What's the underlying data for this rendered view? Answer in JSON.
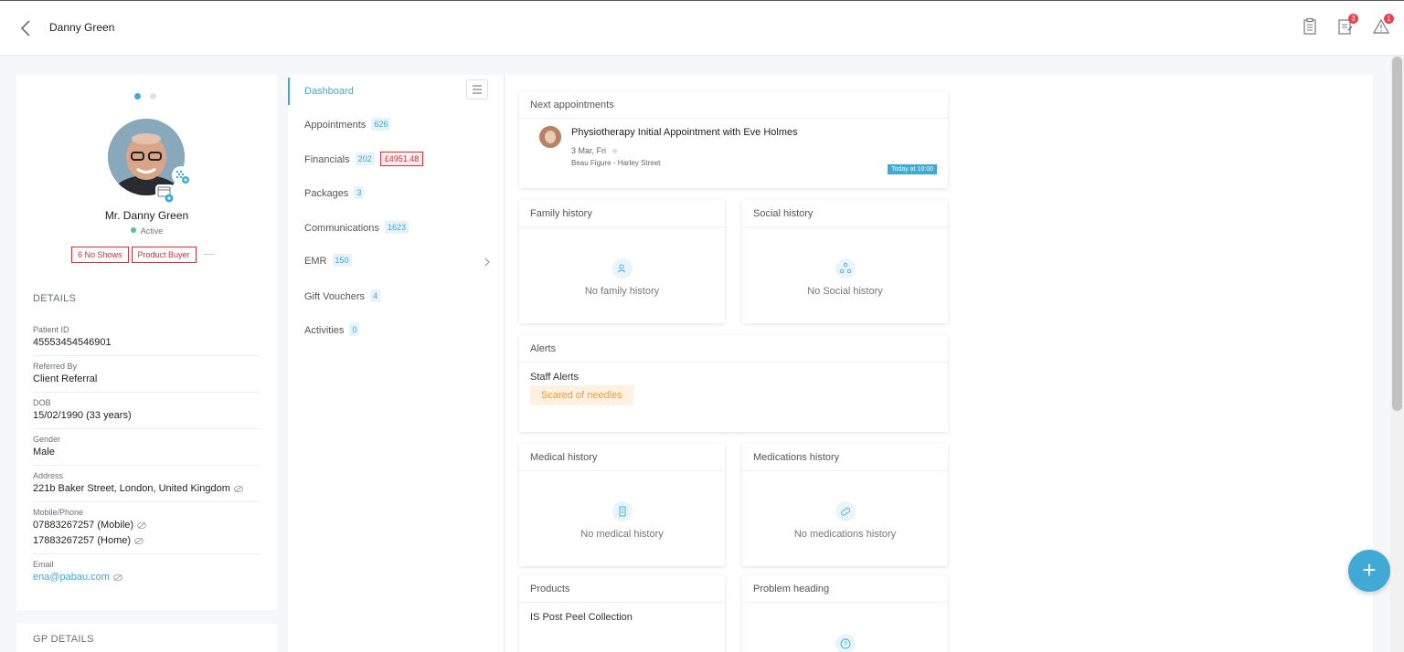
{
  "header": {
    "title": "Danny Green",
    "notes_badge": "3",
    "alerts_badge": "1"
  },
  "profile": {
    "name": "Mr. Danny Green",
    "status": "Active",
    "tags": [
      "6 No Shows",
      "Product Buyer"
    ],
    "details_title": "DETAILS",
    "details": [
      {
        "label": "Patient ID",
        "value": "45553454546901"
      },
      {
        "label": "Referred By",
        "value": "Client Referral"
      },
      {
        "label": "DOB",
        "value": "15/02/1990 (33 years)"
      },
      {
        "label": "Gender",
        "value": "Male"
      },
      {
        "label": "Address",
        "value": "221b Baker Street, London, United Kingdom"
      },
      {
        "label": "Mobile/Phone",
        "value": "07883267257 (Mobile)",
        "value2": "17883267257 (Home)"
      },
      {
        "label": "Email",
        "value": "ena@pabau.com"
      }
    ],
    "gp_title": "GP DETAILS"
  },
  "nav": {
    "items": [
      {
        "label": "Dashboard"
      },
      {
        "label": "Appointments",
        "count": "626"
      },
      {
        "label": "Financials",
        "count": "202",
        "amount": "£4951.48"
      },
      {
        "label": "Packages",
        "count": "3"
      },
      {
        "label": "Communications",
        "count": "1623"
      },
      {
        "label": "EMR",
        "count": "150"
      },
      {
        "label": "Gift Vouchers",
        "count": "4"
      },
      {
        "label": "Activities",
        "count": "0"
      }
    ]
  },
  "dashboard": {
    "next_appointments": {
      "title": "Next appointments",
      "appointment": "Physiotherapy Initial Appointment with Eve Holmes",
      "date": "3 Mar, Fri",
      "location": "Beau Figure - Harley Street",
      "when": "Today at 10:00"
    },
    "family_history": {
      "title": "Family history",
      "empty": "No family history"
    },
    "social_history": {
      "title": "Social history",
      "empty": "No Social history"
    },
    "alerts": {
      "title": "Alerts",
      "subtitle": "Staff Alerts",
      "chip": "Scared of needles"
    },
    "medical_history": {
      "title": "Medical history",
      "empty": "No medical history"
    },
    "medications_history": {
      "title": "Medications history",
      "empty": "No medications history"
    },
    "products": {
      "title": "Products",
      "item": "IS Post Peel Collection"
    },
    "problem_heading": {
      "title": "Problem heading"
    }
  },
  "fab_label": "+",
  "colors": {
    "accent": "#40a9d6",
    "danger": "#d0323a",
    "warning": "#f39a2b",
    "success": "#5cc08a"
  }
}
